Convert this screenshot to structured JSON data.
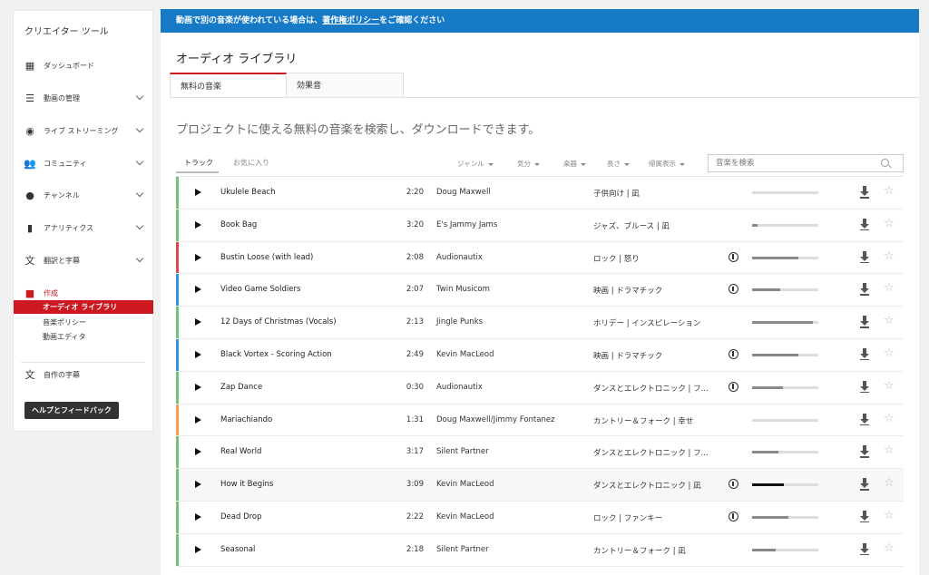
{
  "sidebar": {
    "title": "クリエイター ツール",
    "items": [
      {
        "label": "ダッシュボード",
        "icon": "dashboard-icon"
      },
      {
        "label": "動画の管理",
        "icon": "video-manager-icon"
      },
      {
        "label": "ライブ ストリーミング",
        "icon": "live-icon"
      },
      {
        "label": "コミュニティ",
        "icon": "community-icon"
      },
      {
        "label": "チャンネル",
        "icon": "channel-icon"
      },
      {
        "label": "アナリティクス",
        "icon": "analytics-icon"
      },
      {
        "label": "翻訳と字幕",
        "icon": "translate-icon"
      },
      {
        "label": "作成",
        "icon": "create-icon"
      }
    ],
    "sub_items": [
      "オーディオ ライブラリ",
      "音楽ポリシー",
      "動画エディタ"
    ],
    "own_subtitles": "自作の字幕",
    "help_button": "ヘルプとフィードバック"
  },
  "banner": {
    "prefix": "動画で別の音楽が使われている場合は、",
    "link": "著作権ポリシー",
    "suffix": "をご確認ください"
  },
  "page": {
    "title": "オーディオ ライブラリ",
    "tabs": [
      "無料の音楽",
      "効果音"
    ],
    "headline": "プロジェクトに使える無料の音楽を検索し、ダウンロードできます。"
  },
  "filters": {
    "tabs": [
      "トラック",
      "お気に入り"
    ],
    "dropdowns": [
      "ジャンル",
      "気分",
      "楽器",
      "長さ",
      "帰属表示"
    ],
    "search_placeholder": "音楽を検索"
  },
  "colors": {
    "accent": "#cc181e",
    "banner": "#167ac6",
    "green": "#71c379",
    "red": "#e0474c",
    "blue": "#3d8fd8",
    "orange": "#f0a05a"
  },
  "tracks": [
    {
      "title": "Ukulele Beach",
      "duration": "2:20",
      "artist": "Doug Maxwell",
      "genre": "子供向け | 凪",
      "attribution": false,
      "popularity": 0.0,
      "color": "#71c379"
    },
    {
      "title": "Book Bag",
      "duration": "3:20",
      "artist": "E's Jammy Jams",
      "genre": "ジャズ、ブルース | 凪",
      "attribution": false,
      "popularity": 0.08,
      "color": "#71c379"
    },
    {
      "title": "Bustin Loose (with lead)",
      "duration": "2:08",
      "artist": "Audionautix",
      "genre": "ロック | 怒り",
      "attribution": true,
      "popularity": 0.7,
      "color": "#e0474c"
    },
    {
      "title": "Video Game Soldiers",
      "duration": "2:07",
      "artist": "Twin Musicom",
      "genre": "映画 | ドラマチック",
      "attribution": true,
      "popularity": 0.42,
      "color": "#3d8fd8"
    },
    {
      "title": "12 Days of Christmas (Vocals)",
      "duration": "2:13",
      "artist": "Jingle Punks",
      "genre": "ホリデー | インスピレーション",
      "attribution": false,
      "popularity": 0.92,
      "color": "#71c379"
    },
    {
      "title": "Black Vortex - Scoring Action",
      "duration": "2:49",
      "artist": "Kevin MacLeod",
      "genre": "映画 | ドラマチック",
      "attribution": true,
      "popularity": 0.7,
      "color": "#3d8fd8"
    },
    {
      "title": "Zap Dance",
      "duration": "0:30",
      "artist": "Audionautix",
      "genre": "ダンスとエレクトロニック | フ...",
      "attribution": true,
      "popularity": 0.47,
      "color": "#71c379"
    },
    {
      "title": "Mariachiando",
      "duration": "1:31",
      "artist": "Doug Maxwell/Jimmy Fontanez",
      "genre": "カントリー＆フォーク | 幸せ",
      "attribution": false,
      "popularity": 0.0,
      "color": "#f0a05a"
    },
    {
      "title": "Real World",
      "duration": "3:17",
      "artist": "Silent Partner",
      "genre": "ダンスとエレクトロニック | フ...",
      "attribution": false,
      "popularity": 0.4,
      "color": "#71c379"
    },
    {
      "title": "How it Begins",
      "duration": "3:09",
      "artist": "Kevin MacLeod",
      "genre": "ダンスとエレクトロニック | 凪",
      "attribution": true,
      "popularity": 0.48,
      "color": "#71c379"
    },
    {
      "title": "Dead Drop",
      "duration": "2:22",
      "artist": "Kevin MacLeod",
      "genre": "ロック | ファンキー",
      "attribution": true,
      "popularity": 0.55,
      "color": "#71c379"
    },
    {
      "title": "Seasonal",
      "duration": "2:18",
      "artist": "Silent Partner",
      "genre": "カントリー＆フォーク | 凪",
      "attribution": false,
      "popularity": 0.35,
      "color": "#71c379"
    }
  ]
}
